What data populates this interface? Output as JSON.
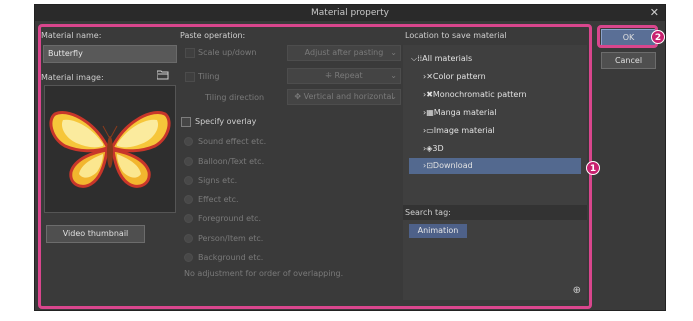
{
  "window": {
    "title": "Material property",
    "close_glyph": "✕"
  },
  "material_name": {
    "label": "Material name:",
    "value": "Butterfly"
  },
  "material_image": {
    "label": "Material image:",
    "folder_icon": "folder-icon"
  },
  "video_thumbnail_label": "Video thumbnail",
  "paste_operation": {
    "label": "Paste operation:",
    "scale": {
      "label": "Scale up/down",
      "option": "Adjust after pasting"
    },
    "tiling": {
      "label": "Tiling",
      "option": "Repeat"
    },
    "tiling_direction": {
      "label": "Tiling direction",
      "option": "Vertical and horizontal"
    }
  },
  "overlay": {
    "label": "Specify overlay",
    "options": [
      "Sound effect etc.",
      "Balloon/Text etc.",
      "Signs etc.",
      "Effect etc.",
      "Foreground etc.",
      "Person/Item etc.",
      "Background etc."
    ],
    "note": "No adjustment for order of overlapping."
  },
  "location": {
    "label": "Location to save material",
    "root": "All materials",
    "items": [
      "Color pattern",
      "Monochromatic pattern",
      "Manga material",
      "Image material",
      "3D",
      "Download"
    ],
    "selected": "Download"
  },
  "search_tag": {
    "label": "Search tag:",
    "tags": [
      "Animation"
    ]
  },
  "buttons": {
    "ok": "OK",
    "cancel": "Cancel"
  },
  "callouts": {
    "one": "1",
    "two": "2"
  },
  "colors": {
    "accent_pink": "#d9468d",
    "selected_row": "#53698f",
    "tag_bg": "#4e6189"
  }
}
